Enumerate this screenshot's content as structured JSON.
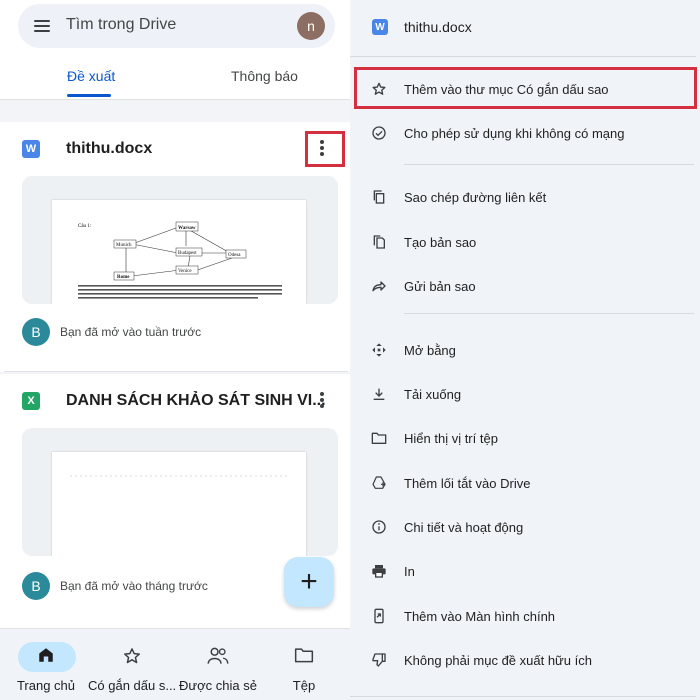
{
  "left": {
    "search": {
      "placeholder": "Tìm trong Drive",
      "avatar_letter": "n"
    },
    "tabs": [
      {
        "label": "Đề xuất",
        "active": true
      },
      {
        "label": "Thông báo",
        "active": false
      }
    ],
    "files": [
      {
        "icon": "W",
        "icon_name": "word-doc-icon",
        "name": "thithu.docx",
        "opened": "Bạn đã mở vào tuần trước",
        "avatar_letter": "B"
      },
      {
        "icon": "X",
        "icon_name": "excel-sheet-icon",
        "name": "DANH SÁCH KHẢO SÁT SINH VI...",
        "opened": "Bạn đã mở vào tháng trước",
        "avatar_letter": "B"
      }
    ],
    "thumb_doc": {
      "label": "Câu 1:",
      "nodes": [
        "Warsaw",
        "Munich",
        "Budapest",
        "Odesa",
        "Rome",
        "Venice"
      ]
    },
    "fab_label": "+",
    "nav": [
      {
        "label": "Trang chủ",
        "icon": "home-icon",
        "active": true
      },
      {
        "label": "Có gắn dấu s...",
        "icon": "star-icon",
        "active": false
      },
      {
        "label": "Được chia sẻ",
        "icon": "people-icon",
        "active": false
      },
      {
        "label": "Tệp",
        "icon": "folder-icon",
        "active": false
      }
    ]
  },
  "right": {
    "file": {
      "icon": "W",
      "name": "thithu.docx"
    },
    "menu": [
      {
        "label": "Thêm vào thư mục Có gắn dấu sao",
        "icon": "star-icon"
      },
      {
        "label": "Cho phép sử dụng khi không có mạng",
        "icon": "offline-icon"
      },
      {
        "label": "Sao chép đường liên kết",
        "icon": "copy-link-icon"
      },
      {
        "label": "Tạo bản sao",
        "icon": "duplicate-icon"
      },
      {
        "label": "Gửi bản sao",
        "icon": "send-copy-icon"
      },
      {
        "label": "Mở bằng",
        "icon": "open-with-icon"
      },
      {
        "label": "Tải xuống",
        "icon": "download-icon"
      },
      {
        "label": "Hiển thị vị trí tệp",
        "icon": "folder-icon"
      },
      {
        "label": "Thêm lối tắt vào Drive",
        "icon": "add-shortcut-icon"
      },
      {
        "label": "Chi tiết và hoạt động",
        "icon": "info-icon"
      },
      {
        "label": "In",
        "icon": "print-icon"
      },
      {
        "label": "Thêm vào Màn hình chính",
        "icon": "add-to-home-icon"
      },
      {
        "label": "Không phải mục đề xuất hữu ích",
        "icon": "thumb-down-icon"
      }
    ]
  },
  "colors": {
    "accent": "#0b57d0",
    "highlight": "#d32f3f",
    "fab": "#c2e7ff",
    "word": "#4a86e8",
    "excel": "#22a565"
  }
}
